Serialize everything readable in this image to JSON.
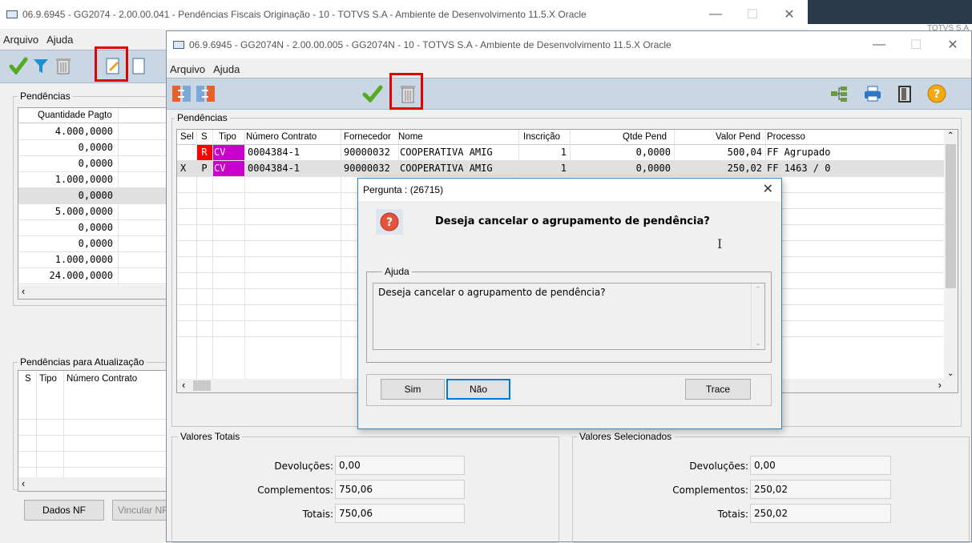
{
  "back_window": {
    "title": "06.9.6945 - GG2074 - 2.00.00.041 - Pendências Fiscais Originação - 10 - TOTVS S.A - Ambiente de Desenvolvimento 11.5.X Oracle",
    "menu": [
      "Arquivo",
      "Ajuda"
    ],
    "pendencias_group": "Pendências",
    "col_quantidade": "Quantidade Pagto",
    "quantidade_values": [
      "4.000,0000",
      "0,0000",
      "0,0000",
      "1.000,0000",
      "0,0000",
      "5.000,0000",
      "0,0000",
      "0,0000",
      "1.000,0000",
      "24.000,0000"
    ],
    "atualizacao_group": "Pendências para Atualização",
    "atualizacao_cols": [
      "S",
      "Tipo",
      "Número Contrato"
    ],
    "btn_dados_nf": "Dados NF",
    "btn_vincular": "Vincular NF"
  },
  "front_window": {
    "title": "06.9.6945 - GG2074N - 2.00.00.005 - GG2074N - 10 - TOTVS S.A - Ambiente de Desenvolvimento 11.5.X Oracle",
    "menu": [
      "Arquivo",
      "Ajuda"
    ],
    "pendencias_group": "Pendências",
    "columns": {
      "sel": "Sel",
      "s": "S",
      "tipo": "Tipo",
      "numero": "Número Contrato",
      "fornecedor": "Fornecedor",
      "nome": "Nome",
      "inscricao": "Inscrição",
      "qtde": "Qtde Pend",
      "valor": "Valor Pend",
      "processo": "Processo"
    },
    "rows": [
      {
        "sel": "",
        "s": "R",
        "tipo": "CV",
        "numero": "0004384-1",
        "fornecedor": "90000032",
        "nome": "COOPERATIVA AMIG",
        "inscricao": "1",
        "qtde": "0,0000",
        "valor": "500,04",
        "processo": "FF Agrupado"
      },
      {
        "sel": "X",
        "s": "P",
        "tipo": "CV",
        "numero": "0004384-1",
        "fornecedor": "90000032",
        "nome": "COOPERATIVA AMIG",
        "inscricao": "1",
        "qtde": "0,0000",
        "valor": "250,02",
        "processo": "FF 1463 / 0"
      }
    ],
    "valores_totais": {
      "label": "Valores Totais",
      "devolucoes_label": "Devoluções:",
      "devolucoes": "0,00",
      "complementos_label": "Complementos:",
      "complementos": "750,06",
      "totais_label": "Totais:",
      "totais": "750,06"
    },
    "valores_selecionados": {
      "label": "Valores Selecionados",
      "devolucoes_label": "Devoluções:",
      "devolucoes": "0,00",
      "complementos_label": "Complementos:",
      "complementos": "250,02",
      "totais_label": "Totais:",
      "totais": "250,02"
    }
  },
  "dialog": {
    "title": "Pergunta : (26715)",
    "message": "Deseja cancelar o agrupamento de pendência?",
    "ajuda_label": "Ajuda",
    "ajuda_text": "Deseja cancelar o agrupamento de pendência?",
    "btn_sim": "Sim",
    "btn_nao": "Não",
    "btn_trace": "Trace"
  },
  "third_window_title": "TOTVS S.A",
  "colors": {
    "accent_red": "#e00000",
    "status_r": "#ff0000",
    "tipo_cv": "#cc00cc",
    "toolbar": "#c9d6e4"
  }
}
